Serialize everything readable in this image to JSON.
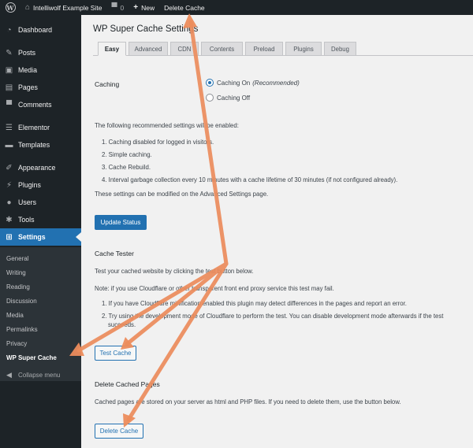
{
  "adminbar": {
    "site_name": "Intelliwolf Example Site",
    "comments_count": "0",
    "new_label": "New",
    "delete_cache_label": "Delete Cache"
  },
  "sidebar": {
    "items": [
      {
        "label": "Dashboard",
        "icon": "dashboard-icon"
      },
      {
        "label": "Posts",
        "icon": "pin-icon"
      },
      {
        "label": "Media",
        "icon": "media-icon"
      },
      {
        "label": "Pages",
        "icon": "pages-icon"
      },
      {
        "label": "Comments",
        "icon": "comment-icon"
      },
      {
        "label": "Elementor",
        "icon": "elementor-icon"
      },
      {
        "label": "Templates",
        "icon": "folder-icon"
      },
      {
        "label": "Appearance",
        "icon": "brush-icon"
      },
      {
        "label": "Plugins",
        "icon": "plug-icon"
      },
      {
        "label": "Users",
        "icon": "user-icon"
      },
      {
        "label": "Tools",
        "icon": "wrench-icon"
      },
      {
        "label": "Settings",
        "icon": "settings-icon"
      }
    ],
    "submenu": [
      "General",
      "Writing",
      "Reading",
      "Discussion",
      "Media",
      "Permalinks",
      "Privacy",
      "WP Super Cache"
    ],
    "collapse_label": "Collapse menu"
  },
  "page": {
    "title": "WP Super Cache Settings",
    "tabs": [
      "Easy",
      "Advanced",
      "CDN",
      "Contents",
      "Preload",
      "Plugins",
      "Debug"
    ]
  },
  "caching": {
    "label": "Caching",
    "on_label": "Caching On",
    "on_note": "(Recommended)",
    "off_label": "Caching Off",
    "recommended_intro": "The following recommended settings will be enabled:",
    "list": [
      "1. Caching disabled for logged in visitors.",
      "2. Simple caching.",
      "3. Cache Rebuild.",
      "4. Interval garbage collection every 10 minutes with a cache lifetime of 30 minutes (if not configured already)."
    ],
    "advanced_note": "These settings can be modified on the Advanced Settings page.",
    "update_button": "Update Status"
  },
  "tester": {
    "heading": "Cache Tester",
    "intro": "Test your cached website by clicking the test button below.",
    "note": "Note: if you use Cloudflare or other transparent front end proxy service this test may fail.",
    "list": [
      "1. If you have Cloudflare minification enabled this plugin may detect differences in the pages and report an error.",
      "2. Try using the development mode of Cloudflare to perform the test. You can disable development mode afterwards if the test",
      "succeeds."
    ],
    "test_button": "Test Cache"
  },
  "delete": {
    "heading": "Delete Cached Pages",
    "text": "Cached pages are stored on your server as html and PHP files. If you need to delete them, use the button below.",
    "button": "Delete Cache"
  }
}
